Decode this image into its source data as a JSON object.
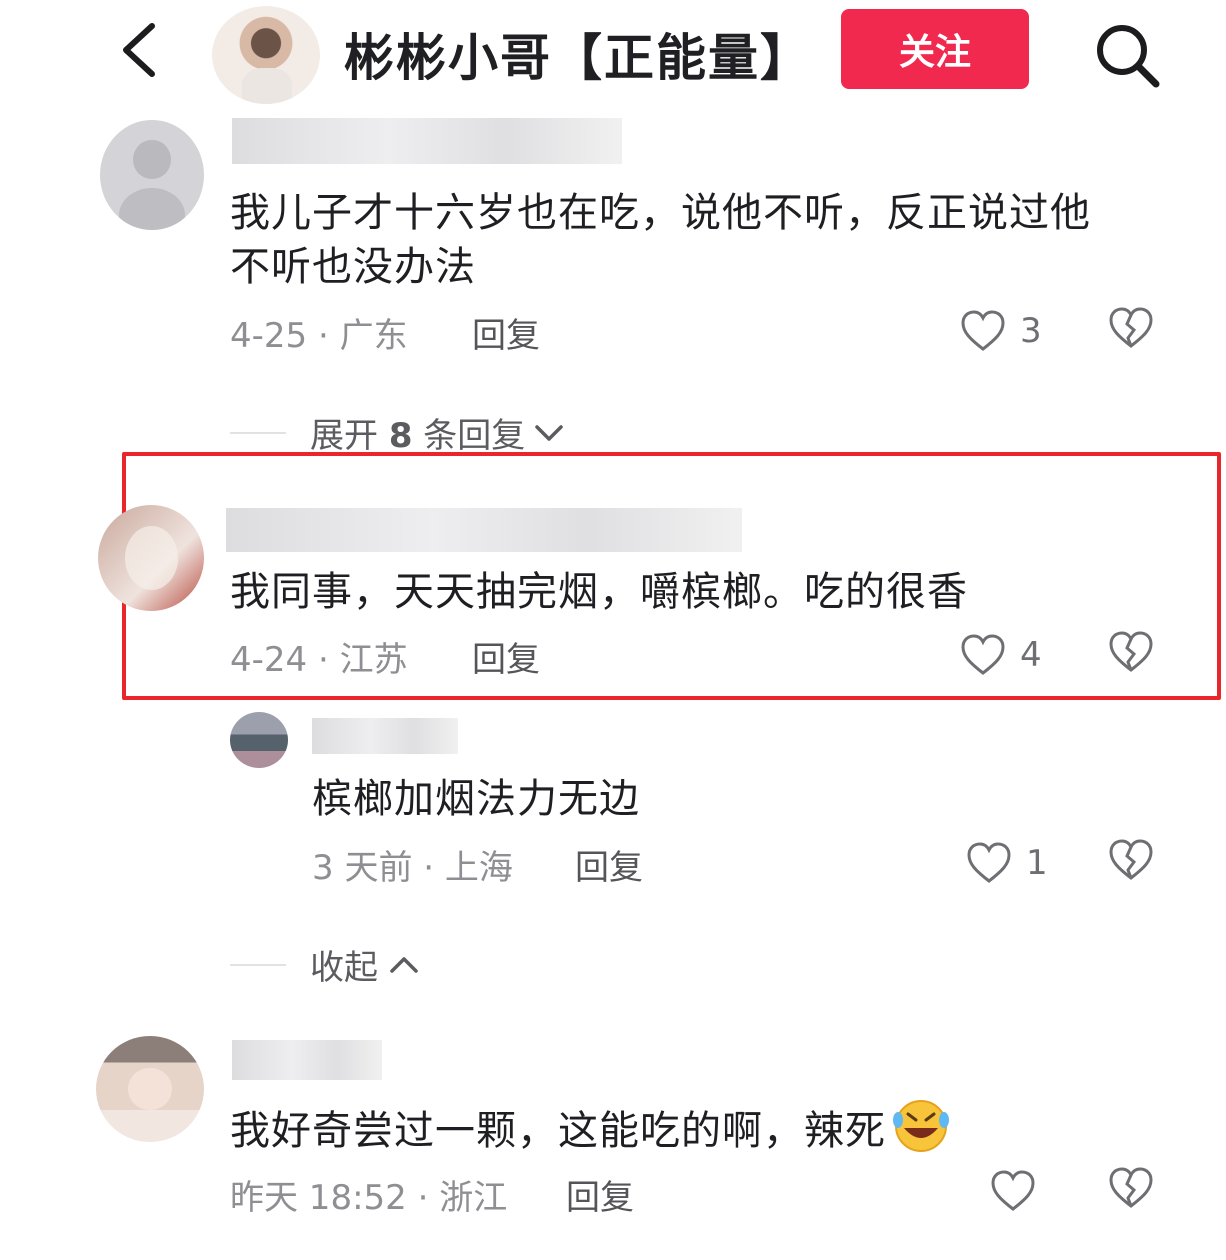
{
  "header": {
    "title": "彬彬小哥【正能量】",
    "follow_label": "关注",
    "back_icon": "chevron-left-icon",
    "search_icon": "search-icon"
  },
  "comments": [
    {
      "text": "我儿子才十六岁也在吃，说他不听，反正说过他不听也没办法",
      "date": "4-25",
      "location": "广东",
      "reply_label": "回复",
      "likes": "3"
    },
    {
      "text": "我同事，天天抽完烟，嚼槟榔。吃的很香",
      "date": "4-24",
      "location": "江苏",
      "reply_label": "回复",
      "likes": "4"
    },
    {
      "text": "我好奇尝过一颗，这能吃的啊，辣死",
      "date": "昨天 18:52",
      "location": "浙江",
      "reply_label": "回复",
      "likes": ""
    }
  ],
  "reply": {
    "text": "槟榔加烟法力无边",
    "date": "3 天前",
    "location": "上海",
    "reply_label": "回复",
    "likes": "1"
  },
  "expand": {
    "prefix": "展开",
    "count": "8",
    "suffix": "条回复"
  },
  "collapse_label": "收起",
  "colors": {
    "accent": "#f1294f",
    "highlight": "#e9262c"
  }
}
